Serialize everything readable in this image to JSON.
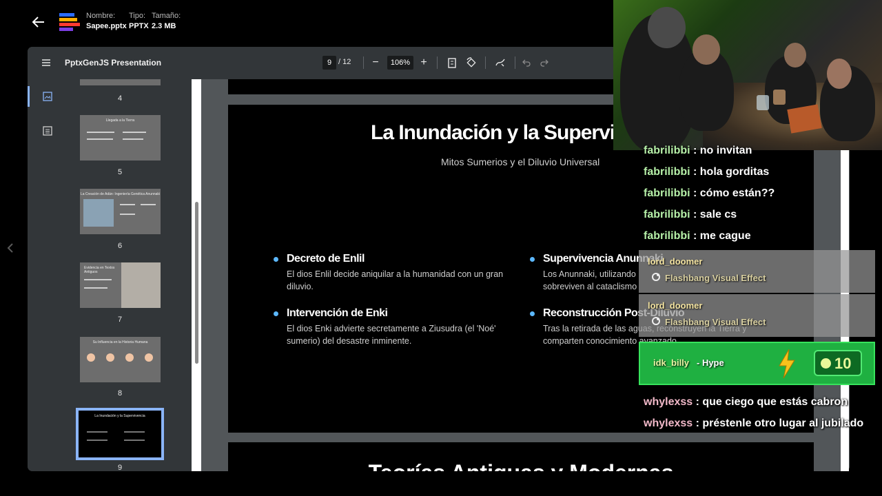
{
  "header": {
    "name_label": "Nombre:",
    "name_value": "Sapee.pptx",
    "type_label": "Tipo:",
    "type_value": "PPTX",
    "size_label": "Tamaño:",
    "size_value": "2.3 MB"
  },
  "viewer": {
    "title": "PptxGenJS Presentation",
    "current_page": "9",
    "total_pages": "/ 12",
    "zoom": "106%",
    "minus": "−",
    "plus": "+",
    "accent": "#8ab4f8"
  },
  "thumbnails": [
    {
      "num": "4",
      "title": ""
    },
    {
      "num": "5",
      "title": "Llegada a la Tierra"
    },
    {
      "num": "6",
      "title": "La Creación de Adán: Ingeniería Genética Anunnaki"
    },
    {
      "num": "7",
      "title": "Evidencia en Textos Antiguos"
    },
    {
      "num": "8",
      "title": "Su Influencia en la Historia Humana"
    },
    {
      "num": "9",
      "title": "La Inundación y la Supervivencia"
    }
  ],
  "slide": {
    "title": "La Inundación y la Supervi",
    "subtitle": "Mitos Sumerios y el Diluvio Universal",
    "bullets": [
      {
        "heading": "Decreto de Enlil",
        "body": "El dios Enlil decide aniquilar a la humanidad con un gran diluvio."
      },
      {
        "heading": "Supervivencia Anunnaki",
        "body": "Los Anunnaki, utilizando sobreviven al cataclismo"
      },
      {
        "heading": "Intervención de Enki",
        "body": "El dios Enki advierte secretamente a Ziusudra (el 'Noé' sumerio) del desastre inminente."
      },
      {
        "heading": "Reconstrucción Post-Diluvio",
        "body": "Tras la retirada de las aguas, reconstruyen la Tierra y comparten conocimiento avanzado."
      }
    ],
    "next_title": "Teorías Antiguas y Modernas"
  },
  "chat": {
    "partial_line": {
      "user": "fabrilibbi",
      "text": " : no invitan"
    },
    "lines": [
      {
        "user": "fabrilibbi",
        "text": " : hola gorditas"
      },
      {
        "user": "fabrilibbi",
        "text": " : cómo están??"
      },
      {
        "user": "fabrilibbi",
        "text": " : sale cs"
      },
      {
        "user": "fabrilibbi",
        "text": " : me cague"
      }
    ],
    "redeems": [
      {
        "user": "lord_doomer",
        "effect": "Flashbang Visual Effect"
      },
      {
        "user": "lord_doomer",
        "effect": "Flashbang Visual Effect"
      }
    ],
    "hype": {
      "user": "idk_billy",
      "label": "- Hype",
      "amount": "10"
    },
    "lines2": [
      {
        "user": "whylexss",
        "text": " : que ciego que estás cabron"
      },
      {
        "user": "whylexss",
        "text": " : préstenle otro lugar al jubilado"
      }
    ],
    "user_color_1": "#b6f0a8",
    "user_color_2": "#f2b9c9"
  }
}
